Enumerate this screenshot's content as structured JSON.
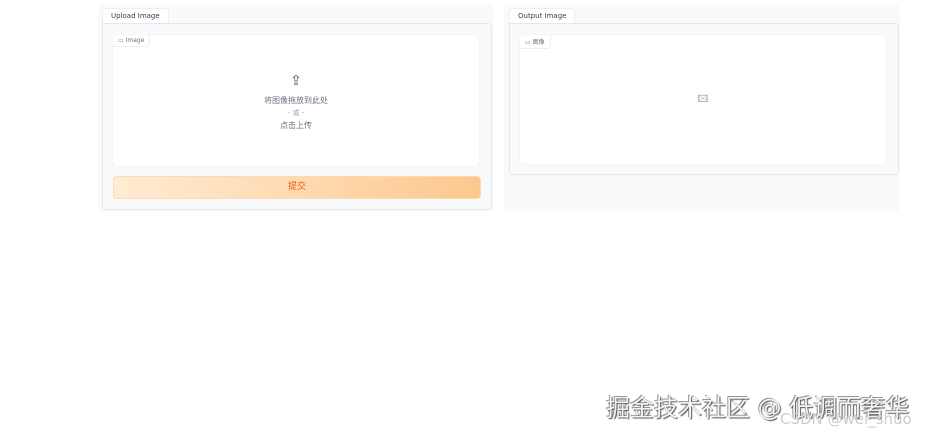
{
  "input": {
    "tab": "Upload Image",
    "label": "Image",
    "drop_text": "将图像拖放到此处",
    "or_text": "- 或 -",
    "click_text": "点击上传",
    "submit": "提交"
  },
  "output": {
    "tab": "Output Image",
    "label": "图像"
  },
  "watermark": {
    "main": "掘金技术社区 @ 低调而奢华",
    "sub": "CSDN @wei_shuo"
  }
}
